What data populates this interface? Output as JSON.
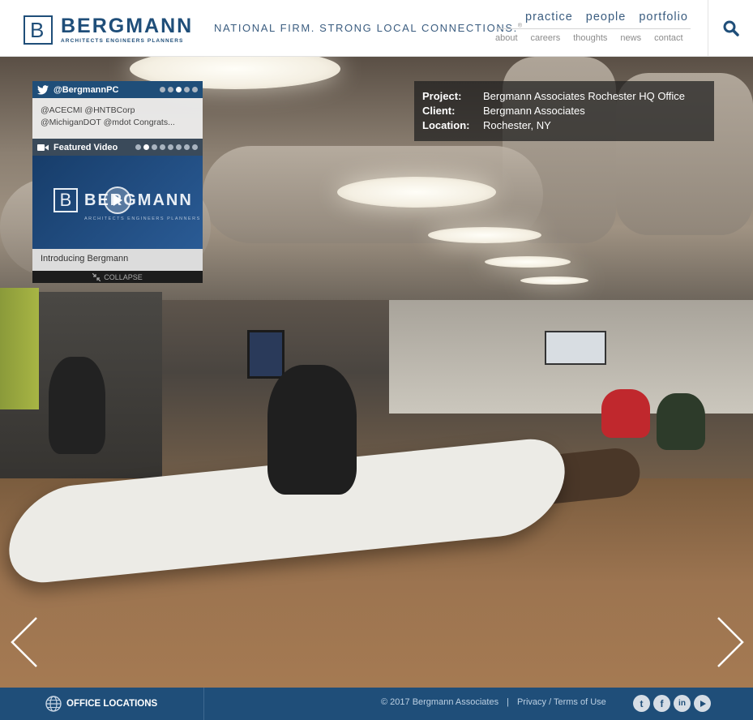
{
  "brand": {
    "logo_letter": "B",
    "name": "BERGMANN",
    "subtitle": "ARCHITECTS  ENGINEERS  PLANNERS",
    "tagline": "NATIONAL FIRM. STRONG LOCAL CONNECTIONS.",
    "tagline_mark": "®",
    "color": "#1f4e79"
  },
  "nav": {
    "primary": [
      "practice",
      "people",
      "portfolio"
    ],
    "secondary": [
      "about",
      "careers",
      "thoughts",
      "news",
      "contact"
    ]
  },
  "search": {
    "icon": "search-icon"
  },
  "twitter": {
    "handle": "@BergmannPC",
    "tweet": "@ACECMI @HNTBCorp @MichiganDOT @mdot Congrats...",
    "active_dot": 2,
    "dot_count": 5
  },
  "video": {
    "header": "Featured Video",
    "logo_letter": "B",
    "logo_name": "BERGMANN",
    "logo_sub": "ARCHITECTS ENGINEERS PLANNERS",
    "caption": "Introducing Bergmann",
    "collapse_label": "COLLAPSE",
    "active_dot": 1,
    "dot_count": 8
  },
  "project": {
    "rows": [
      {
        "label": "Project:",
        "value": "Bergmann Associates Rochester HQ Office"
      },
      {
        "label": "Client:",
        "value": "Bergmann Associates"
      },
      {
        "label": "Location:",
        "value": "Rochester, NY"
      }
    ]
  },
  "footer": {
    "office_label": "OFFICE LOCATIONS",
    "copyright": "© 2017 Bergmann Associates",
    "separator": "|",
    "privacy": "Privacy / Terms of Use",
    "social": [
      "twitter-icon",
      "facebook-icon",
      "linkedin-icon",
      "youtube-icon"
    ]
  }
}
